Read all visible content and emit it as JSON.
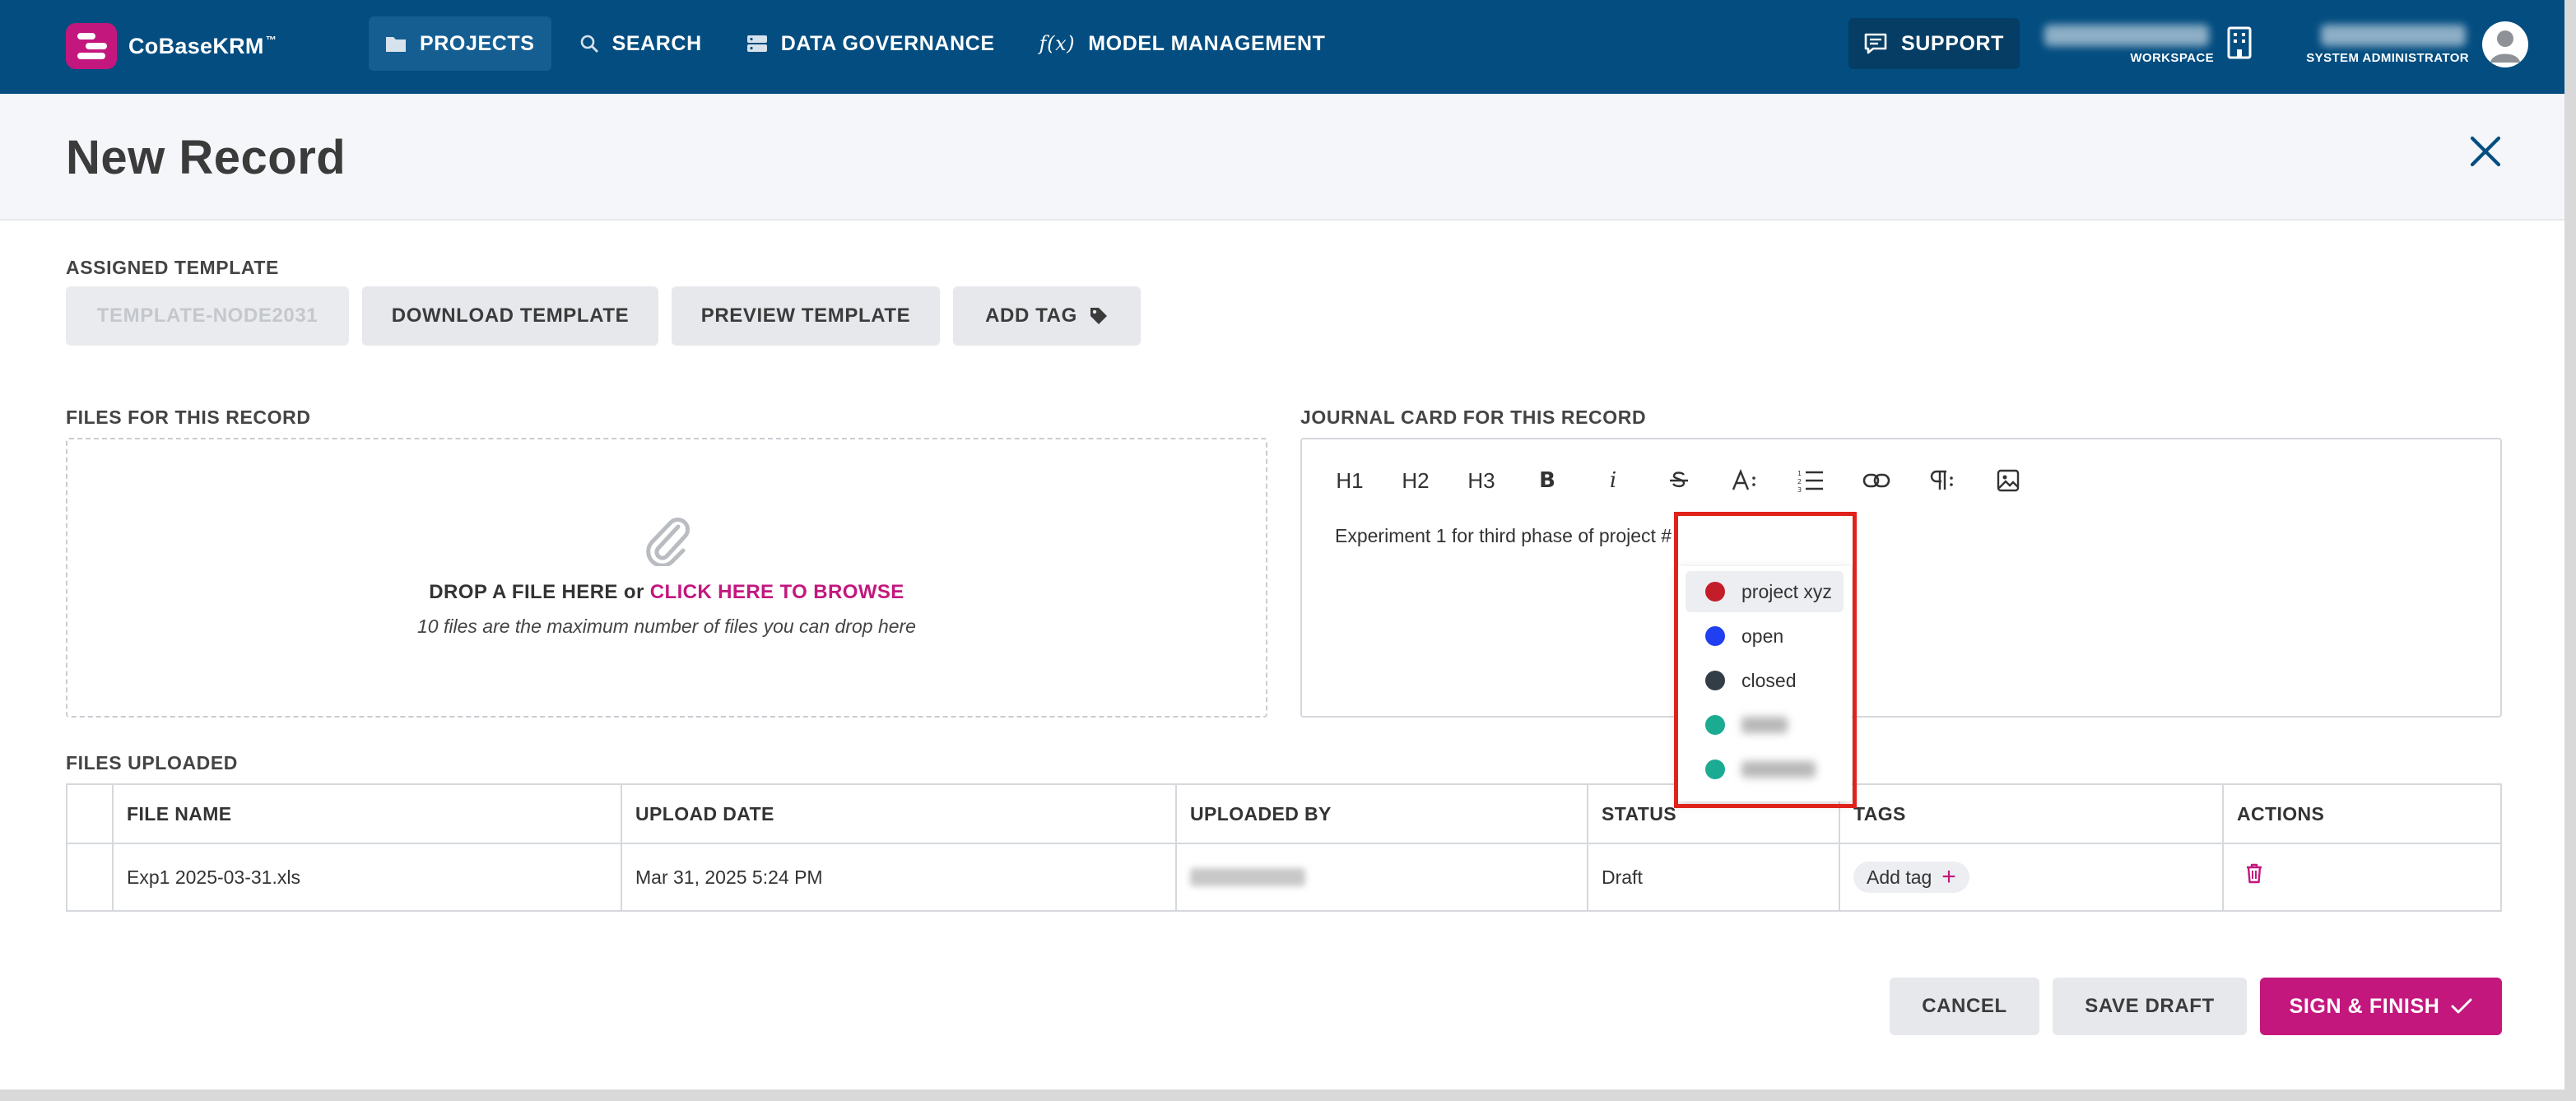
{
  "app": {
    "name": "CoBaseKRM",
    "trademark": "™"
  },
  "nav": {
    "items": [
      {
        "label": "PROJECTS",
        "icon": "folder-icon",
        "active": true
      },
      {
        "label": "SEARCH",
        "icon": "search-icon",
        "active": false
      },
      {
        "label": "DATA GOVERNANCE",
        "icon": "database-icon",
        "active": false
      },
      {
        "label": "MODEL MANAGEMENT",
        "icon": "function-icon",
        "icon_text": "f(x)",
        "active": false
      }
    ],
    "support_label": "SUPPORT",
    "workspace_label": "WORKSPACE",
    "role_label": "SYSTEM ADMINISTRATOR"
  },
  "page": {
    "title": "New Record"
  },
  "template": {
    "section_label": "ASSIGNED TEMPLATE",
    "template_name": "TEMPLATE-NODE2031",
    "download_label": "DOWNLOAD TEMPLATE",
    "preview_label": "PREVIEW TEMPLATE",
    "add_tag_label": "ADD TAG"
  },
  "files": {
    "section_label": "FILES FOR THIS RECORD",
    "drop_text": "DROP A FILE HERE or ",
    "browse_link": "CLICK HERE TO BROWSE",
    "drop_note": "10 files are the maximum number of files you can drop here"
  },
  "journal": {
    "section_label": "JOURNAL CARD FOR THIS RECORD",
    "toolbar": [
      "H1",
      "H2",
      "H3",
      "bold-icon",
      "italic-icon",
      "strikethrough-icon",
      "font-size-icon",
      "ordered-list-icon",
      "link-icon",
      "paragraph-icon",
      "image-icon"
    ],
    "text": "Experiment 1 for third phase of project #",
    "tag_suggestions": [
      {
        "label": "project xyz",
        "color": "#c41d2a",
        "highlighted": true,
        "blurred": false
      },
      {
        "label": "open",
        "color": "#1f3ff0",
        "highlighted": false,
        "blurred": false
      },
      {
        "label": "closed",
        "color": "#333d45",
        "highlighted": false,
        "blurred": false
      },
      {
        "label": "",
        "color": "#1bab93",
        "highlighted": false,
        "blurred": true
      },
      {
        "label": "",
        "color": "#1bab93",
        "highlighted": false,
        "blurred": true
      }
    ]
  },
  "uploaded": {
    "section_label": "FILES UPLOADED",
    "columns": [
      "",
      "FILE NAME",
      "UPLOAD DATE",
      "UPLOADED BY",
      "STATUS",
      "TAGS",
      "ACTIONS"
    ],
    "rows": [
      {
        "file_name": "Exp1 2025-03-31.xls",
        "upload_date": "Mar 31, 2025 5:24 PM",
        "uploaded_by": "",
        "status": "Draft",
        "tag_button": "Add tag"
      }
    ]
  },
  "footer": {
    "cancel_label": "CANCEL",
    "save_draft_label": "SAVE DRAFT",
    "sign_finish_label": "SIGN & FINISH"
  },
  "colors": {
    "navbar": "#034d80",
    "accent": "#c3177e",
    "highlight": "#e0221c"
  }
}
